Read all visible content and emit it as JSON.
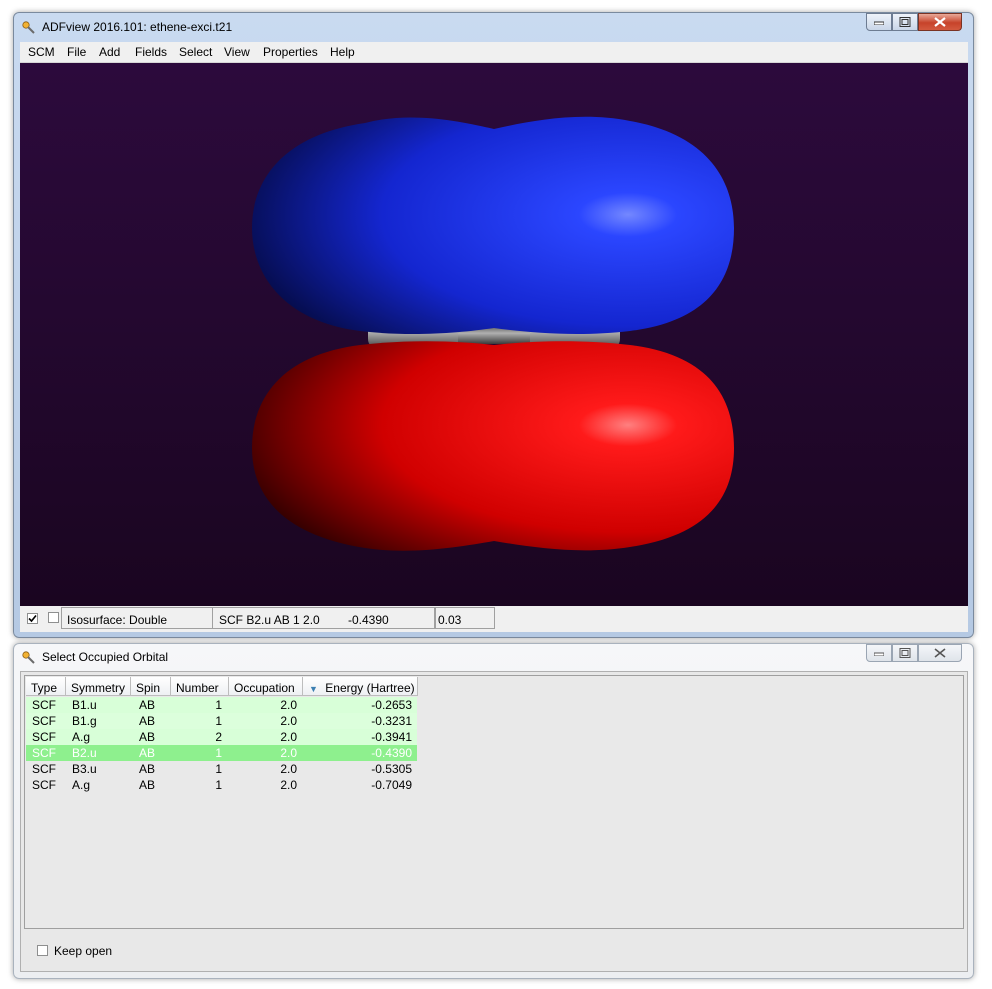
{
  "main_window": {
    "title": "ADFview 2016.101: ethene-exci.t21",
    "menu": [
      "SCM",
      "File",
      "Add",
      "Fields",
      "Select",
      "View",
      "Properties",
      "Help"
    ],
    "status": {
      "visible_checked": true,
      "isosurface_label": "Isosurface: Double",
      "orbital_info": "SCF B2.u AB 1 2.0",
      "energy": "-0.4390",
      "isovalue": "0.03"
    },
    "colors": {
      "positive_lobe": "#1630e0",
      "negative_lobe": "#e81010",
      "atoms": "#808080"
    }
  },
  "orbital_window": {
    "title": "Select Occupied Orbital",
    "columns": [
      "Type",
      "Symmetry",
      "Spin",
      "Number",
      "Occupation",
      "Energy (Hartree)"
    ],
    "sort_indicator": "▼",
    "rows": [
      {
        "type": "SCF",
        "symmetry": "B1.u",
        "spin": "AB",
        "number": "1",
        "occupation": "2.0",
        "energy": "-0.2653",
        "state": "occupied"
      },
      {
        "type": "SCF",
        "symmetry": "B1.g",
        "spin": "AB",
        "number": "1",
        "occupation": "2.0",
        "energy": "-0.3231",
        "state": "occupied"
      },
      {
        "type": "SCF",
        "symmetry": "A.g",
        "spin": "AB",
        "number": "2",
        "occupation": "2.0",
        "energy": "-0.3941",
        "state": "occupied"
      },
      {
        "type": "SCF",
        "symmetry": "B2.u",
        "spin": "AB",
        "number": "1",
        "occupation": "2.0",
        "energy": "-0.4390",
        "state": "selected"
      },
      {
        "type": "SCF",
        "symmetry": "B3.u",
        "spin": "AB",
        "number": "1",
        "occupation": "2.0",
        "energy": "-0.5305",
        "state": "plain"
      },
      {
        "type": "SCF",
        "symmetry": "A.g",
        "spin": "AB",
        "number": "1",
        "occupation": "2.0",
        "energy": "-0.7049",
        "state": "plain"
      }
    ],
    "keep_open_label": "Keep open",
    "keep_open_checked": false
  }
}
